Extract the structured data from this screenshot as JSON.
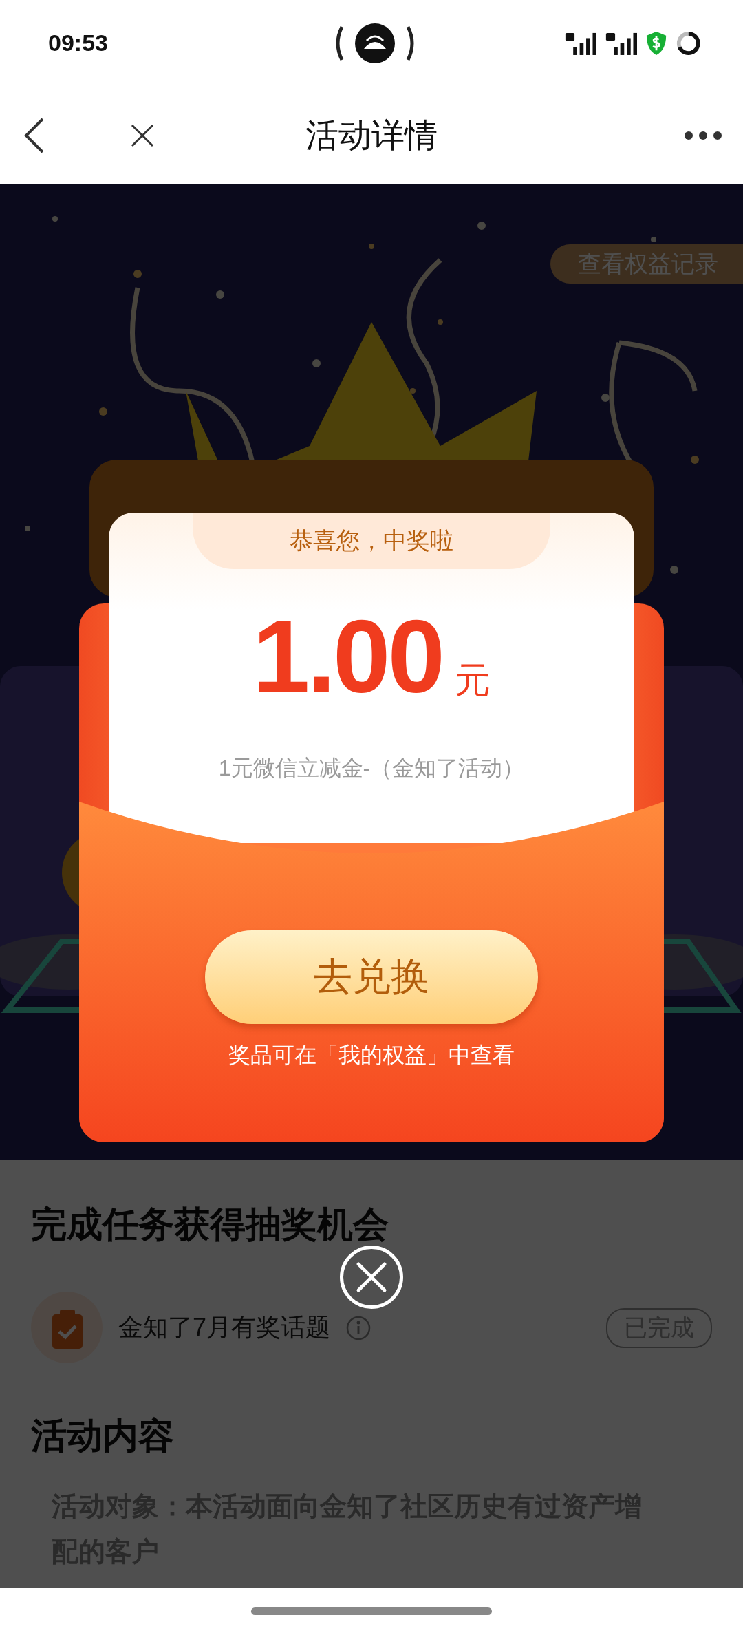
{
  "status_bar": {
    "time": "09:53"
  },
  "nav_bar": {
    "title": "活动详情"
  },
  "banner": {
    "records_button": "查看权益记录"
  },
  "tasks_section": {
    "title": "完成任务获得抽奖机会",
    "tasks": [
      {
        "title": "金知了7月有奖话题",
        "status": "已完成",
        "completed": true
      }
    ]
  },
  "activity_section": {
    "title": "活动内容",
    "paragraphs": [
      "活动对象：本活动面向金知了社区历史有过资产增配的客户"
    ]
  },
  "prize_dialog": {
    "greeting": "恭喜您，中奖啦",
    "amount": "1.00",
    "unit": "元",
    "description": "1元微信立减金-（金知了活动）",
    "button": "去兑换",
    "note": "奖品可在「我的权益」中查看"
  }
}
